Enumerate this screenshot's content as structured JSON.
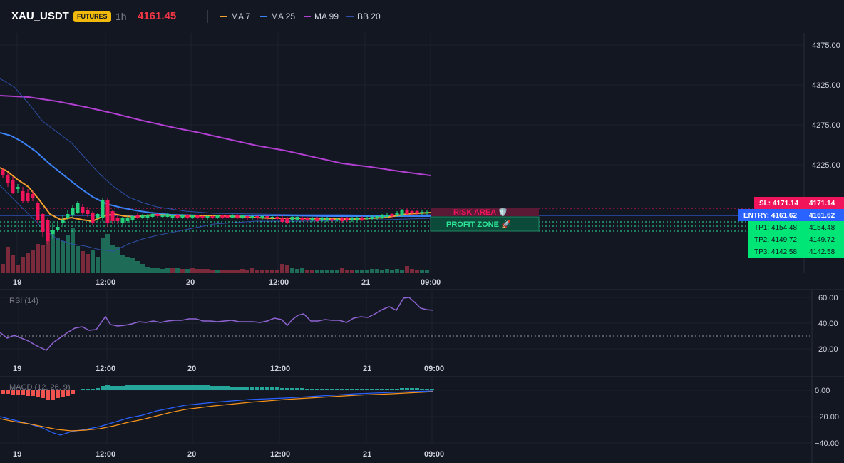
{
  "header": {
    "symbol": "XAU_USDT",
    "badge": "FUTURES",
    "timeframe": "1h",
    "last_price": "4161.45",
    "legend": [
      {
        "label": "MA 7",
        "color": "#f7a12e"
      },
      {
        "label": "MA 25",
        "color": "#3b82f6"
      },
      {
        "label": "MA 99",
        "color": "#b13fd1"
      },
      {
        "label": "BB 20",
        "color": "#2f4fa8"
      }
    ]
  },
  "colors": {
    "background": "#131722",
    "grid": "#1e222d",
    "up": "#26d07c",
    "down": "#f0145a",
    "ma7": "#f7a12e",
    "ma25": "#3b82f6",
    "ma99": "#b13fd1",
    "bb": "#2f4fa8",
    "rsi": "#8e63d2",
    "macd_line": "#2962ff",
    "signal_line": "#f7931a"
  },
  "main_chart": {
    "price_ticks": [
      "4375.00",
      "4325.00",
      "4275.00",
      "4225.00"
    ],
    "time_ticks": [
      "19",
      "12:00",
      "20",
      "12:00",
      "21",
      "09:00"
    ],
    "zones": {
      "risk_label": "RISK AREA 🛡️",
      "profit_label": "PROFIT ZONE 🚀"
    },
    "levels": [
      {
        "name": "sl-label",
        "text": "SL: 4171.14",
        "value": "4171.14",
        "color": "#f0145a"
      },
      {
        "name": "entry-label",
        "text": "ENTRY: 4161.62",
        "value": "4161.62",
        "color": "#2962ff"
      },
      {
        "name": "tp1-label",
        "text": "TP1: 4154.48",
        "value": "4154.48",
        "color": "#00e676"
      },
      {
        "name": "tp2-label",
        "text": "TP2: 4149.72",
        "value": "4149.72",
        "color": "#00e676"
      },
      {
        "name": "tp3-label",
        "text": "TP3: 4142.58",
        "value": "4142.58",
        "color": "#00e676"
      }
    ]
  },
  "rsi_pane": {
    "title": "RSI (14)",
    "ticks": [
      "60.00",
      "40.00",
      "20.00"
    ],
    "time_ticks": [
      "19",
      "12:00",
      "20",
      "12:00",
      "21",
      "09:00"
    ]
  },
  "macd_pane": {
    "title": "MACD (12, 26, 9)",
    "ticks": [
      "0.00",
      "−20.00",
      "−40.00"
    ],
    "time_ticks": [
      "19",
      "12:00",
      "20",
      "12:00",
      "21",
      "09:00"
    ]
  }
}
